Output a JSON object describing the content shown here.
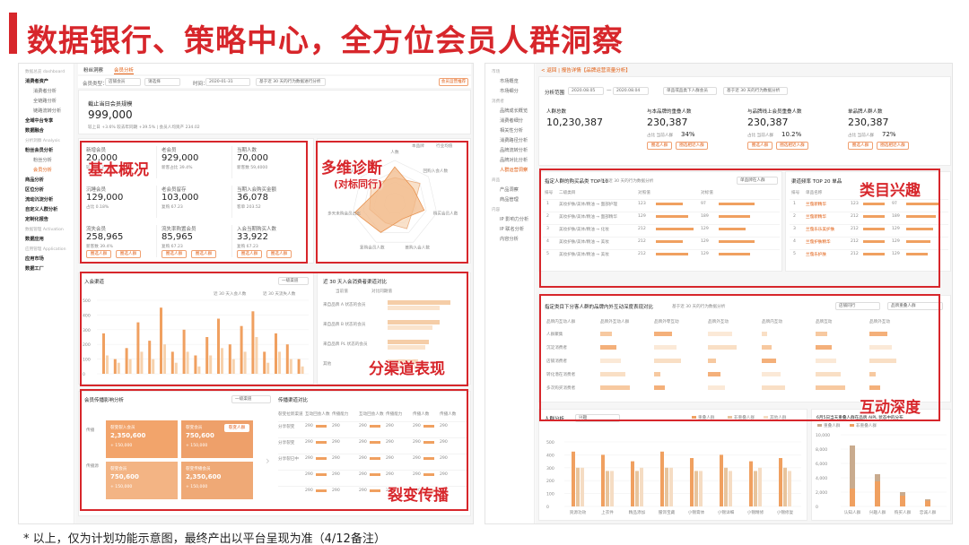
{
  "page_title": "数据银行、策略中心，全方位会员人群洞察",
  "footnote": "* 以上，仅为计划功能示意图，最终产出以平台呈现为准（4/12备注）",
  "annotations": {
    "basic": "基本概况",
    "multi": "多维诊断",
    "multi_sub": "(对标同行)",
    "channel": "分渠道表现",
    "fission": "裂变传播",
    "category": "类目兴趣",
    "interaction": "互动深度"
  },
  "left": {
    "sidebar": [
      {
        "label": "数据总览 dashboard",
        "style": "g"
      },
      {
        "label": "消费者资产",
        "style": "b"
      },
      {
        "label": "消费者分析",
        "style": "s"
      },
      {
        "label": "全链路分析",
        "style": "s"
      },
      {
        "label": "链路流转分析",
        "style": "s"
      },
      {
        "label": "全域中台专享",
        "style": "b"
      },
      {
        "label": "数据融合",
        "style": "b"
      },
      {
        "label": "分析洞察 Analysis",
        "style": "g"
      },
      {
        "label": "粉丝会员分析",
        "style": "b"
      },
      {
        "label": "粉丝分析",
        "style": "s"
      },
      {
        "label": "会员分析",
        "style": "s a"
      },
      {
        "label": "商品分析",
        "style": "b"
      },
      {
        "label": "区位分析",
        "style": "b"
      },
      {
        "label": "流动沉淀分析",
        "style": "b"
      },
      {
        "label": "自定义人群分析",
        "style": "b"
      },
      {
        "label": "定制化报告",
        "style": "b"
      },
      {
        "label": "数据管理 Activation",
        "style": "g"
      },
      {
        "label": "数据应用",
        "style": "b"
      },
      {
        "label": "应用管理 Application",
        "style": "g"
      },
      {
        "label": "应用市场",
        "style": "b"
      },
      {
        "label": "数据工厂",
        "style": "b"
      }
    ],
    "tabs": [
      "粉丝洞察",
      "会员分析"
    ],
    "filters": {
      "type_label": "会员类型：",
      "type_value": "店铺会员",
      "level_value": "请选择",
      "time_label": "时间：",
      "date_value": "2020-01-31",
      "compare_value": "基于近 30 天的行为数据进行分析",
      "export": "会员运营推荐"
    },
    "summary": {
      "title": "截止当日会员规模",
      "value": "999,000",
      "sub": "较上日 +3.6%  较去年同期 +39.5%  |  会员人均资产 234.02"
    },
    "kpis": [
      {
        "label": "新增会员",
        "value": "20,000",
        "sub": "较上日 -3%"
      },
      {
        "label": "老会员",
        "value": "929,000",
        "sub": "新客占比 39.4%"
      },
      {
        "label": "当期人数",
        "value": "70,000",
        "sub": "新客数 59,4000"
      },
      {
        "label": "沉睡会员",
        "value": "129,000",
        "sub": "占比 0.18%"
      },
      {
        "label": "老会员留存",
        "value": "103,000",
        "sub": "复购 67.23"
      },
      {
        "label": "当期入会购买金额",
        "value": "36,078",
        "sub": "客单 203.52"
      },
      {
        "label": "流失会员",
        "value": "258,965",
        "sub": "新客数 39.4%"
      },
      {
        "label": "流失率购置会员",
        "value": "85,965",
        "sub": "复购 67.23"
      },
      {
        "label": "入会当期购买人数",
        "value": "33,922",
        "sub": "复购 67.23"
      }
    ],
    "kpi_btn": "圈选人群",
    "radar": {
      "legend": [
        "本品牌",
        "行业均值"
      ],
      "axes": [
        "人数",
        "回购入会人数",
        "购买会员人数",
        "首购入会人数",
        "复购会员人数",
        "多天未购会员占比",
        "会员流转"
      ]
    },
    "channel": {
      "title": "入会渠道",
      "select": "一级渠道",
      "legend": [
        "近 30 天入会人数",
        "近 30 天流失人数"
      ],
      "yticks": [
        "500",
        "400",
        "300",
        "200",
        "100",
        "0"
      ]
    },
    "channel_compare": {
      "title": "近 30 天入会消费者渠道对比",
      "legend": [
        "当前值",
        "对比同期值"
      ],
      "rows": [
        "来自品牌 A 状态的会员",
        "来自品牌 B 状态的会员",
        "来自品牌 PL 状态的会员",
        "其他"
      ]
    },
    "fission": {
      "title": "会员传播影响分析",
      "select": "一级渠道",
      "rows": [
        "传播",
        "传播源"
      ],
      "boxes": [
        {
          "label": "裂变裂入会员",
          "value": "2,350,600",
          "sub": "+ 150,000"
        },
        {
          "label": "裂变会员",
          "value": "750,600",
          "sub": "+ 150,000"
        },
        {
          "label": "裂变会员",
          "value": "750,600",
          "sub": "+ 150,000"
        },
        {
          "label": "裂变传播会员",
          "value": "2,350,600",
          "sub": "+ 150,000"
        }
      ],
      "btn": "裂变人群"
    },
    "fission_table": {
      "title": "传播渠道对比",
      "headers": [
        "裂变拉新渠道",
        "互动回会人数",
        "传播能力",
        "互动回会人数",
        "传播能力",
        "传播人数",
        "传播人数"
      ],
      "rows": [
        {
          "name": "分享裂变",
          "v": "290"
        },
        {
          "name": "分享裂变",
          "v": "290"
        },
        {
          "name": "分享裂已中",
          "v": "290"
        },
        {
          "name": "",
          "v": "290"
        },
        {
          "name": "",
          "v": "290"
        }
      ]
    }
  },
  "right": {
    "sidebar": [
      {
        "label": "市场",
        "style": "g"
      },
      {
        "label": "市场概览",
        "style": "s"
      },
      {
        "label": "市场细分",
        "style": "s"
      },
      {
        "label": "消费者",
        "style": "g"
      },
      {
        "label": "品牌成长概览",
        "style": "s"
      },
      {
        "label": "消费者细分",
        "style": "s"
      },
      {
        "label": "相关性分析",
        "style": "s"
      },
      {
        "label": "消费路径分析",
        "style": "s"
      },
      {
        "label": "品牌流转分析",
        "style": "s"
      },
      {
        "label": "品牌对比分析",
        "style": "s"
      },
      {
        "label": "人群运营洞察",
        "style": "s a"
      },
      {
        "label": "商品",
        "style": "g"
      },
      {
        "label": "产品洞察",
        "style": "s"
      },
      {
        "label": "商品管理",
        "style": "s"
      },
      {
        "label": "内容",
        "style": "g"
      },
      {
        "label": "IP 影响力分析",
        "style": "s"
      },
      {
        "label": "IP 联名分析",
        "style": "s"
      },
      {
        "label": "内容分析",
        "style": "s"
      }
    ],
    "breadcrumb": "< 返回 | 报告详情【品牌运营流量分析】",
    "filters": {
      "range_label": "分析范围",
      "date_from": "2020.08.05",
      "date_to": "2020.08.04",
      "opt1": "单品或品类下人群会员",
      "opt2": "基于近 30 天的行为数据分析"
    },
    "kpis": [
      {
        "label": "人群总数",
        "value": "10,230,387",
        "sub": "",
        "pct": ""
      },
      {
        "label": "与本品牌的重叠人数",
        "value": "230,387",
        "sub": "占比 当前人群",
        "pct": "34%"
      },
      {
        "label": "与品牌线上会员重叠人数",
        "value": "230,387",
        "sub": "占比 当前人群",
        "pct": "10.2%"
      },
      {
        "label": "单品牌人群人数",
        "value": "230,387",
        "sub": "占比 当前人群",
        "pct": "72%"
      }
    ],
    "kpi_btns": [
      "圈选人群",
      "圈选相近人群"
    ],
    "cat_table": {
      "title": "指定人群的购买品类 TOP 10",
      "note": "基于近 30 天的行为数据分析",
      "select": "单品牌在人群",
      "headers": [
        "排号",
        "二级类目",
        "对照值",
        "对标值"
      ],
      "rows": [
        {
          "rank": "1",
          "name": "美妆护肤/美体/精油 → 面部护理",
          "a": "123",
          "b": "97"
        },
        {
          "rank": "2",
          "name": "美妆护肤/美体/精油 → 面部精华",
          "a": "129",
          "b": "189"
        },
        {
          "rank": "3",
          "name": "美妆护肤/美体/精油 → 化妆",
          "a": "212",
          "b": "129"
        },
        {
          "rank": "4",
          "name": "美妆护肤/美体/精油 → 美妆",
          "a": "212",
          "b": "129"
        },
        {
          "rank": "5",
          "name": "美妆护肤/美体/精油 → 美妆",
          "a": "212",
          "b": "129"
        }
      ]
    },
    "brand_table": {
      "title": "渠道频率 TOP 20 单品",
      "headers": [
        "排号",
        "单品名称"
      ],
      "rows": [
        {
          "rank": "1",
          "name": "兰蔻新精华",
          "a": "123",
          "b": "97"
        },
        {
          "rank": "2",
          "name": "兰蔻新精华",
          "a": "212",
          "b": "189"
        },
        {
          "rank": "3",
          "name": "兰蔻乐乐美护肤",
          "a": "212",
          "b": "129"
        },
        {
          "rank": "4",
          "name": "兰蔻护肤精华",
          "a": "212",
          "b": "129"
        },
        {
          "rank": "5",
          "name": "兰蔻乐护肤",
          "a": "212",
          "b": "129"
        }
      ]
    },
    "heat": {
      "title": "指定类目下分客人群的品牌内外互动深度表现对比",
      "note": "基于近 30 天的行为数据分析",
      "select1": "店铺同行",
      "select2": "品牌重叠人群",
      "headers": [
        "品牌内互动人群",
        "品牌外互动人群",
        "品牌外零互动",
        "品牌外互动",
        "品牌内互动",
        "品牌互动",
        "品牌外互动"
      ],
      "rows": [
        "人群聚集",
        "沉淀消费者",
        "店铺消费者",
        "转化潜在消费者",
        "多次购买消费者"
      ]
    },
    "bar_chart": {
      "title": "人群分析",
      "select": "兴趣",
      "legend": [
        "重叠人群",
        "非重叠人群",
        "其他人群"
      ],
      "yticks": [
        "500",
        "400",
        "300",
        "200",
        "100",
        "0"
      ],
      "categories": [
        "资源功效",
        "上衣件",
        "精品添加",
        "服饰宝藏",
        "小锦膏体",
        "小锦详细",
        "小锦精修",
        "小锦修复"
      ]
    },
    "side_chart": {
      "title": "6月5日当天重叠人群在品牌 AIPL 状态中的分布",
      "legend": [
        "重叠人群",
        "非重叠人群"
      ],
      "yticks": [
        "10,000",
        "8,000",
        "6,000",
        "4,000",
        "2,000",
        "0"
      ],
      "categories": [
        "认知人群",
        "兴趣人群",
        "购买人群",
        "忠诚人群"
      ]
    }
  }
}
